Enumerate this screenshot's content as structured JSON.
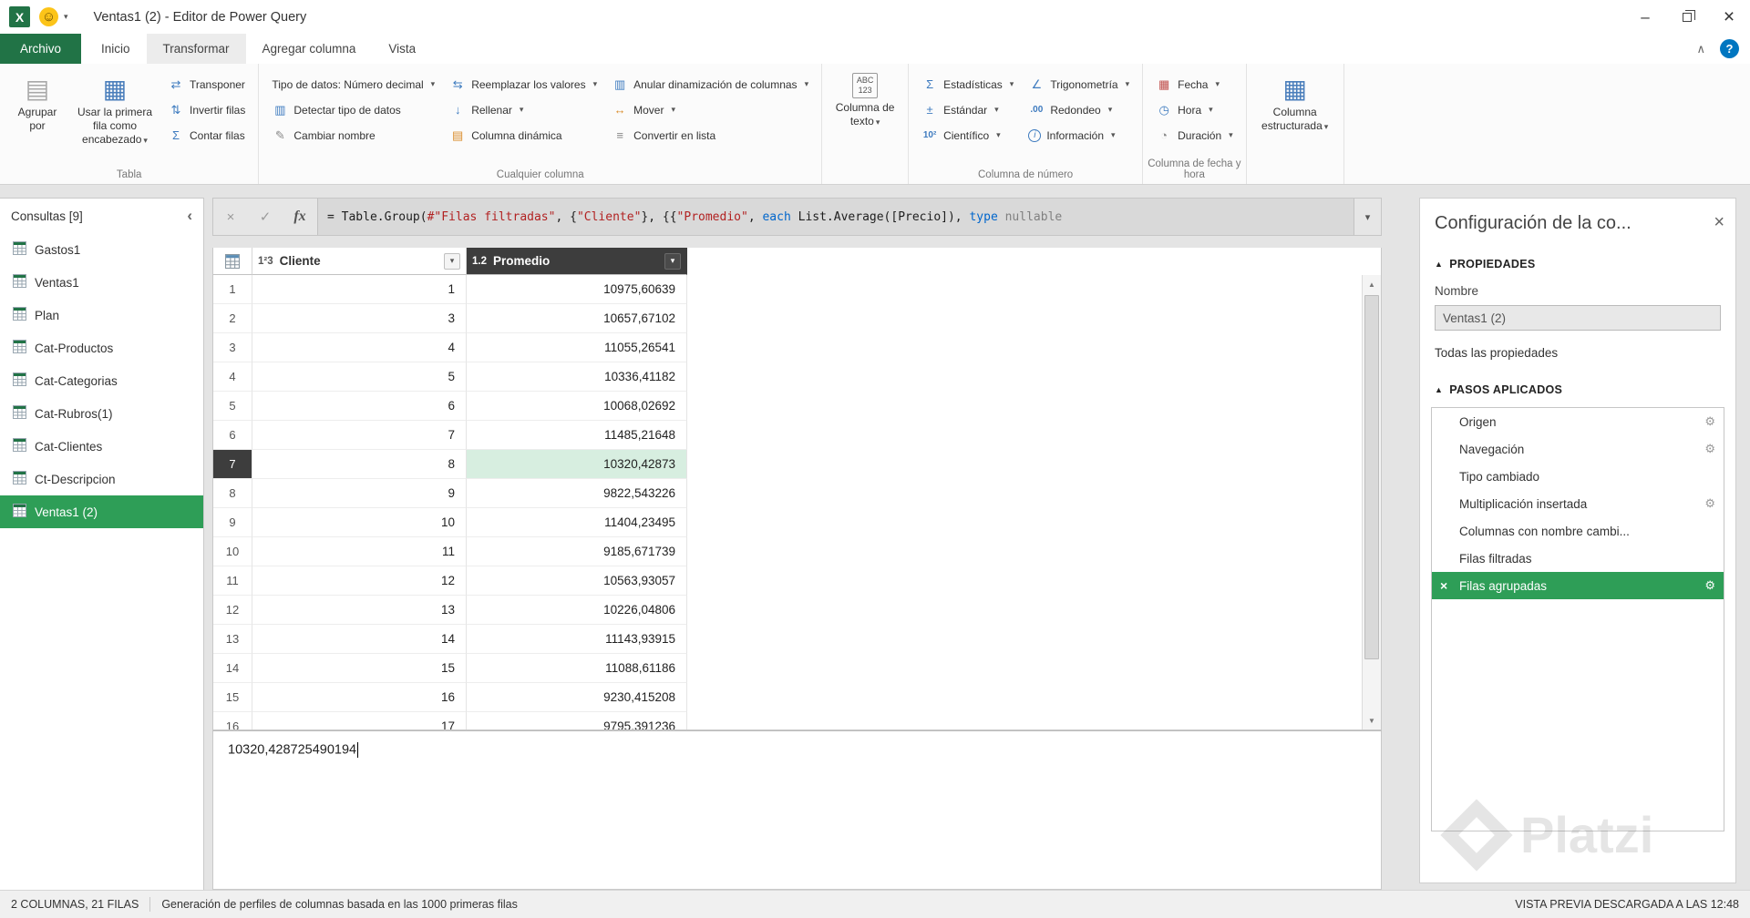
{
  "window": {
    "title": "Ventas1 (2) - Editor de Power Query"
  },
  "menu_tabs": {
    "archivo": "Archivo",
    "inicio": "Inicio",
    "transformar": "Transformar",
    "agregar_columna": "Agregar columna",
    "vista": "Vista"
  },
  "ribbon": {
    "tabla": {
      "label": "Tabla",
      "agrupar_por": "Agrupar por",
      "usar_primera_fila": "Usar la primera fila como encabezado",
      "transponer": "Transponer",
      "invertir_filas": "Invertir filas",
      "contar_filas": "Contar filas"
    },
    "cualquier": {
      "label": "Cualquier columna",
      "tipo_de_datos": "Tipo de datos: Número decimal",
      "detectar_tipo": "Detectar tipo de datos",
      "cambiar_nombre": "Cambiar nombre",
      "reemplazar_valores": "Reemplazar los valores",
      "rellenar": "Rellenar",
      "columna_dinamica": "Columna dinámica",
      "anular_dinamizacion": "Anular dinamización de columnas",
      "mover": "Mover",
      "convertir_en_lista": "Convertir en lista"
    },
    "texto": {
      "boton": "Columna de texto",
      "icon_abc": "ABC",
      "icon_123": "123"
    },
    "numero": {
      "label": "Columna de número",
      "estadisticas": "Estadísticas",
      "estandar": "Estándar",
      "cientifico": "Científico",
      "trigonometria": "Trigonometría",
      "redondeo": "Redondeo",
      "informacion": "Información"
    },
    "fecha": {
      "label": "Columna de fecha y hora",
      "fecha": "Fecha",
      "hora": "Hora",
      "duracion": "Duración"
    },
    "estructurada": {
      "boton": "Columna estructurada"
    }
  },
  "sidebar": {
    "header": "Consultas [9]",
    "queries": [
      {
        "label": "Gastos1"
      },
      {
        "label": "Ventas1"
      },
      {
        "label": "Plan"
      },
      {
        "label": "Cat-Productos"
      },
      {
        "label": "Cat-Categorias"
      },
      {
        "label": "Cat-Rubros(1)"
      },
      {
        "label": "Cat-Clientes"
      },
      {
        "label": "Ct-Descripcion"
      },
      {
        "label": "Ventas1 (2)",
        "selected": true
      }
    ]
  },
  "formula": {
    "segments": [
      {
        "text": "= Table.Group(",
        "type": "plain"
      },
      {
        "text": "#\"Filas filtradas\"",
        "type": "string"
      },
      {
        "text": ", {",
        "type": "plain"
      },
      {
        "text": "\"Cliente\"",
        "type": "string"
      },
      {
        "text": "}, {{",
        "type": "plain"
      },
      {
        "text": "\"Promedio\"",
        "type": "string"
      },
      {
        "text": ", ",
        "type": "plain"
      },
      {
        "text": "each",
        "type": "keyword"
      },
      {
        "text": " List.Average([Precio]), ",
        "type": "plain"
      },
      {
        "text": "type",
        "type": "keyword"
      },
      {
        "text": " nullable",
        "type": "muted"
      }
    ]
  },
  "table": {
    "columns": [
      {
        "type_badge": "1²3",
        "name": "Cliente"
      },
      {
        "type_badge": "1.2",
        "name": "Promedio",
        "selected": true
      }
    ],
    "rows": [
      {
        "n": "1",
        "cliente": "1",
        "promedio": "10975,60639"
      },
      {
        "n": "2",
        "cliente": "3",
        "promedio": "10657,67102"
      },
      {
        "n": "3",
        "cliente": "4",
        "promedio": "11055,26541"
      },
      {
        "n": "4",
        "cliente": "5",
        "promedio": "10336,41182"
      },
      {
        "n": "5",
        "cliente": "6",
        "promedio": "10068,02692"
      },
      {
        "n": "6",
        "cliente": "7",
        "promedio": "11485,21648"
      },
      {
        "n": "7",
        "cliente": "8",
        "promedio": "10320,42873",
        "selected": true
      },
      {
        "n": "8",
        "cliente": "9",
        "promedio": "9822,543226"
      },
      {
        "n": "9",
        "cliente": "10",
        "promedio": "11404,23495"
      },
      {
        "n": "10",
        "cliente": "11",
        "promedio": "9185,671739"
      },
      {
        "n": "11",
        "cliente": "12",
        "promedio": "10563,93057"
      },
      {
        "n": "12",
        "cliente": "13",
        "promedio": "10226,04806"
      },
      {
        "n": "13",
        "cliente": "14",
        "promedio": "11143,93915"
      },
      {
        "n": "14",
        "cliente": "15",
        "promedio": "11088,61186"
      },
      {
        "n": "15",
        "cliente": "16",
        "promedio": "9230,415208"
      },
      {
        "n": "16",
        "cliente": "17",
        "promedio": "9795,391236"
      }
    ]
  },
  "preview": {
    "value": "10320,428725490194"
  },
  "settings_panel": {
    "title": "Configuración de la co...",
    "propiedades_header": "PROPIEDADES",
    "nombre_label": "Nombre",
    "nombre_value": "Ventas1 (2)",
    "todas_link": "Todas las propiedades",
    "pasos_header": "PASOS APLICADOS",
    "steps": [
      {
        "label": "Origen",
        "gear": true
      },
      {
        "label": "Navegación",
        "gear": true
      },
      {
        "label": "Tipo cambiado",
        "gear": false
      },
      {
        "label": "Multiplicación insertada",
        "gear": true
      },
      {
        "label": "Columnas con nombre cambi...",
        "gear": false
      },
      {
        "label": "Filas filtradas",
        "gear": false
      },
      {
        "label": "Filas agrupadas",
        "gear": true,
        "selected": true
      }
    ]
  },
  "status_bar": {
    "columns_rows": "2 COLUMNAS, 21 FILAS",
    "profile_info": "Generación de perfiles de columnas basada en las 1000 primeras filas",
    "preview_time": "VISTA PREVIA DESCARGADA A LAS 12:48"
  },
  "watermark": "Platzi",
  "icons": {
    "dropdown": "▾",
    "group_by": "▤",
    "first_row": "▦",
    "transpose": "⇄",
    "reverse": "⇅",
    "count": "Σ",
    "detect": "▥",
    "rename": "✎",
    "replace": "⇆",
    "fill": "↓",
    "pivot": "▤",
    "unpivot": "▥",
    "move": "↔",
    "list": "≡",
    "stats": "Σ",
    "standard": "±",
    "scientific": "10²",
    "trig": "∠",
    "round": ".00",
    "info": "i",
    "date": "▦",
    "time": "◷",
    "duration": "◔",
    "structured": "▦",
    "gear": "⚙",
    "close": "×",
    "check": "✓",
    "cancel": "×",
    "fx": "fx",
    "collapse": "∧",
    "help": "?",
    "chevron_left": "‹",
    "up": "▲",
    "down": "▼",
    "smiley": "☺",
    "minimize": "–",
    "excel": "X"
  }
}
